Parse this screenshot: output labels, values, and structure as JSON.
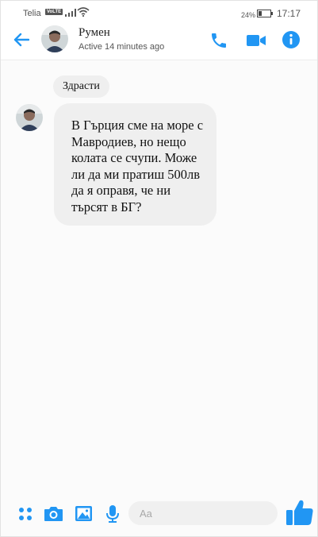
{
  "status_bar": {
    "carrier": "Telia",
    "network_badge": "VoLTE",
    "battery_percent": "24%",
    "time": "17:17"
  },
  "header": {
    "contact_name": "Румен",
    "active_status": "Active 14 minutes ago"
  },
  "messages": [
    {
      "text": "Здрасти"
    },
    {
      "text": "В Гърция сме на море с Мавродиев, но нещо колата се счупи. Може ли да ми пратиш 500лв да я оправя, че ни търсят в БГ?"
    }
  ],
  "composer": {
    "placeholder": "Aa"
  },
  "colors": {
    "accent": "#2196f3",
    "bubble": "#efefef",
    "background": "#fbfbfb"
  }
}
